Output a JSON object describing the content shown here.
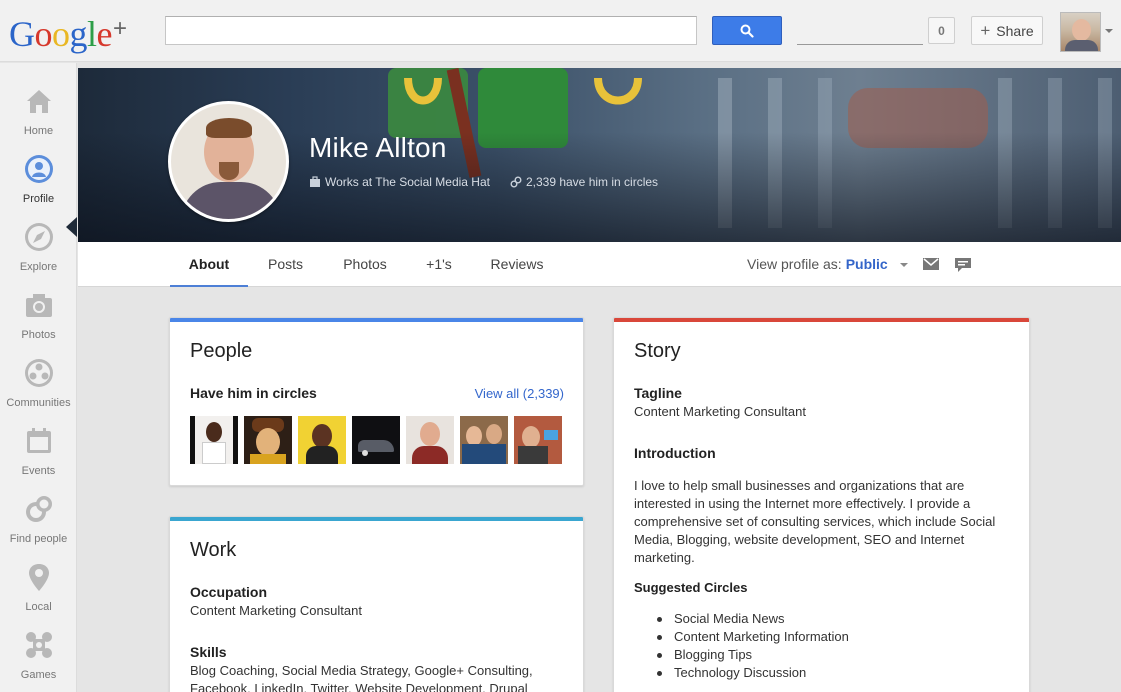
{
  "topbar": {
    "logo": {
      "g": "G",
      "o1": "o",
      "o2": "o",
      "g2": "g",
      "l": "l",
      "e": "e",
      "plus": "+"
    },
    "search_placeholder": "",
    "search_icon": "search-icon",
    "notification_count": "0",
    "share_label": "Share",
    "colors": {
      "search_button": "#3d7ce8"
    }
  },
  "nav": {
    "items": [
      {
        "label": "Home",
        "icon": "home-icon"
      },
      {
        "label": "Profile",
        "icon": "profile-icon"
      },
      {
        "label": "Explore",
        "icon": "compass-icon"
      },
      {
        "label": "Photos",
        "icon": "camera-icon"
      },
      {
        "label": "Communities",
        "icon": "communities-icon"
      },
      {
        "label": "Events",
        "icon": "calendar-icon"
      },
      {
        "label": "Find people",
        "icon": "find-people-icon"
      },
      {
        "label": "Local",
        "icon": "map-pin-icon"
      },
      {
        "label": "Games",
        "icon": "games-icon"
      }
    ],
    "active": "Profile"
  },
  "profile": {
    "name": "Mike Allton",
    "works_at": "Works at The Social Media Hat",
    "circles": "2,339 have him in circles"
  },
  "tabs": [
    {
      "label": "About",
      "active": true
    },
    {
      "label": "Posts"
    },
    {
      "label": "Photos"
    },
    {
      "label": "+1's"
    },
    {
      "label": "Reviews"
    }
  ],
  "view_as": {
    "prefix": "View profile as:",
    "value": "Public"
  },
  "people": {
    "title": "People",
    "subtitle": "Have him in circles",
    "view_all": "View all (2,339)",
    "accent": "#4a86e8"
  },
  "work": {
    "title": "Work",
    "occupation_label": "Occupation",
    "occupation": "Content Marketing Consultant",
    "skills_label": "Skills",
    "skills": "Blog Coaching, Social Media Strategy, Google+ Consulting,",
    "skills2": "Facebook, LinkedIn, Twitter, Website Development, Drupal",
    "accent": "#3aa6d0"
  },
  "story": {
    "title": "Story",
    "tagline_label": "Tagline",
    "tagline": "Content Marketing Consultant",
    "intro_label": "Introduction",
    "intro": "I love to help small businesses and organizations that are interested in using the Internet more effectively. I provide a comprehensive set of consulting services, which include Social Media, Blogging, website development, SEO and Internet marketing.",
    "circles_label": "Suggested Circles",
    "circles": [
      "Social Media News",
      "Content Marketing Information",
      "Blogging Tips",
      "Technology Discussion"
    ],
    "accent": "#d9473a"
  }
}
